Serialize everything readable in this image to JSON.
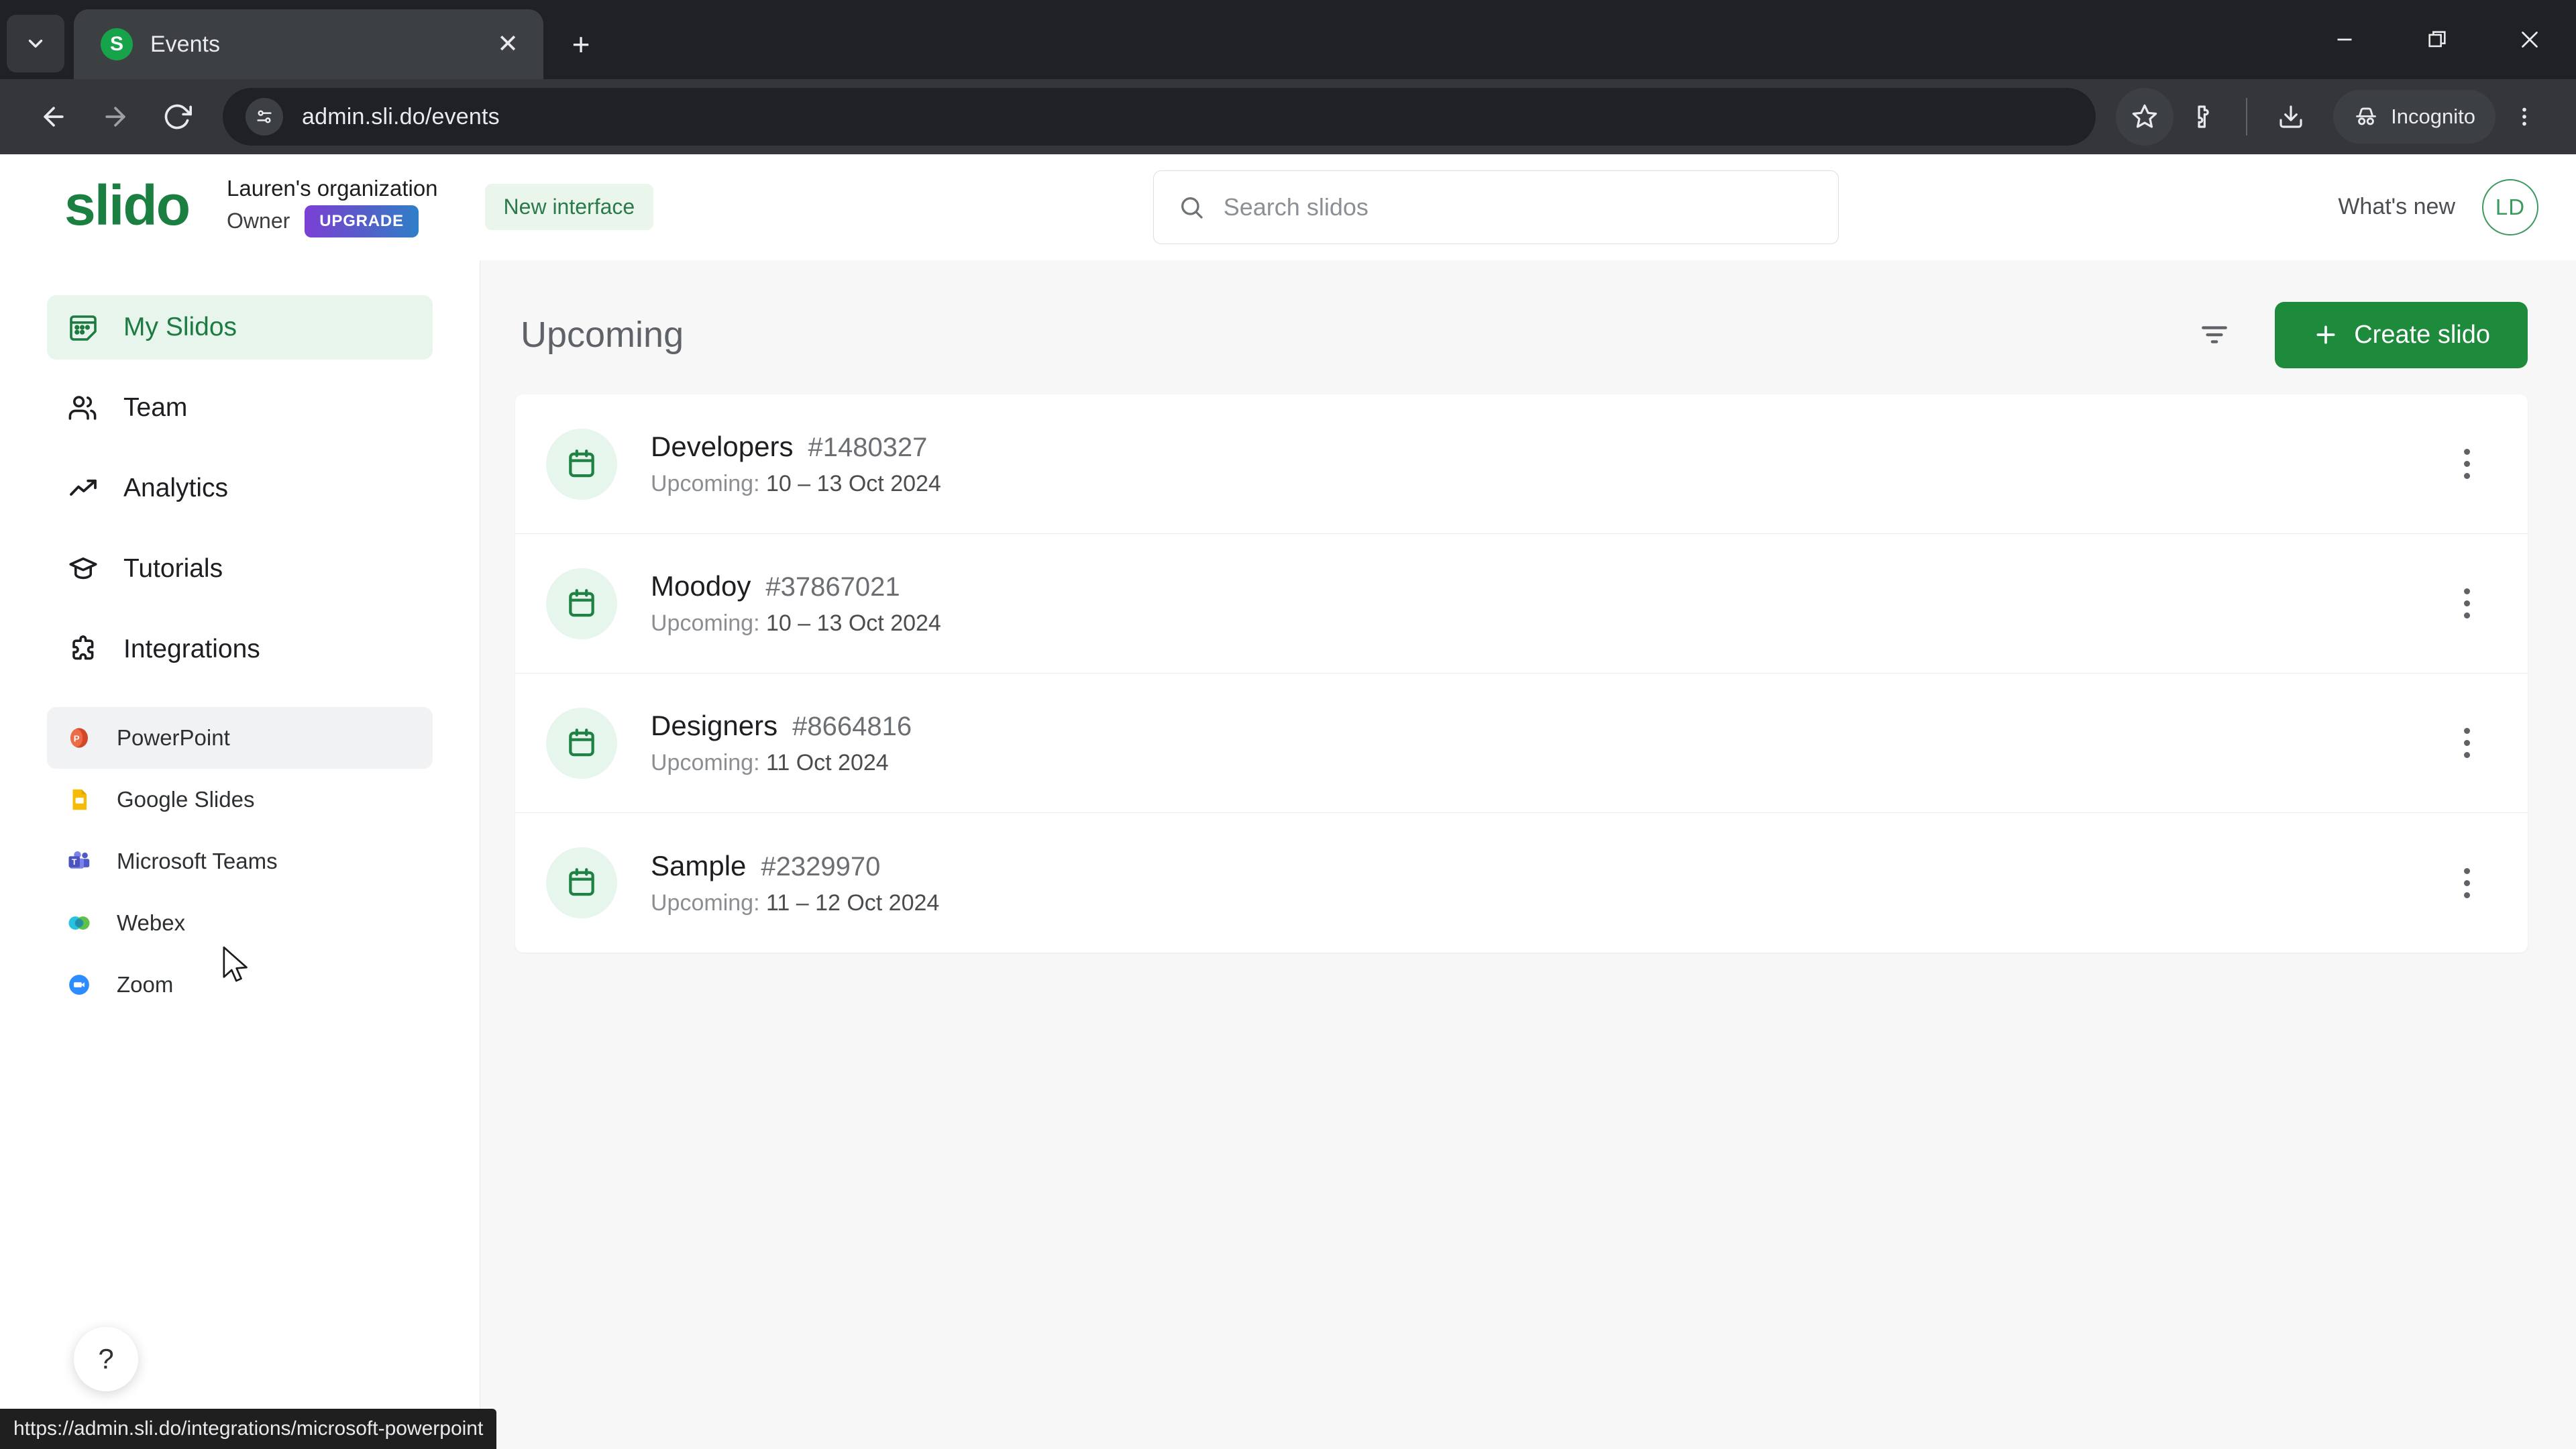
{
  "browser": {
    "tab": {
      "title": "Events",
      "favicon_letter": "S",
      "favicon_name": "slido-favicon"
    },
    "tab_list_icon": "chevron-down-icon",
    "new_tab_icon": "plus-icon",
    "window_controls": [
      "minimize-icon",
      "restore-icon",
      "close-icon"
    ],
    "nav": {
      "back": "back-arrow-icon",
      "forward": "forward-arrow-icon",
      "reload": "reload-icon"
    },
    "omnibox": {
      "site_info_icon": "site-settings-icon",
      "url": "admin.sli.do/events"
    },
    "actions": {
      "bookmark": "star-icon",
      "extensions": "extensions-puzzle-icon",
      "downloads": "download-icon",
      "profile_label": "Incognito",
      "profile_icon": "incognito-hat-icon",
      "menu": "three-dot-menu-icon"
    },
    "status_url": "https://admin.sli.do/integrations/microsoft-powerpoint"
  },
  "header": {
    "logo": "slido",
    "org_name": "Lauren's organization",
    "org_role": "Owner",
    "upgrade_label": "UPGRADE",
    "new_interface_label": "New interface",
    "search_placeholder": "Search slidos",
    "search_value": "",
    "whats_new_label": "What's new",
    "avatar_initials": "LD"
  },
  "sidebar": {
    "items": [
      {
        "label": "My Slidos",
        "icon": "calendar-grid-icon",
        "active": true
      },
      {
        "label": "Team",
        "icon": "people-icon",
        "active": false
      },
      {
        "label": "Analytics",
        "icon": "trend-up-icon",
        "active": false
      },
      {
        "label": "Tutorials",
        "icon": "graduation-cap-icon",
        "active": false
      },
      {
        "label": "Integrations",
        "icon": "puzzle-piece-icon",
        "active": false
      }
    ],
    "integrations": [
      {
        "label": "PowerPoint",
        "icon": "powerpoint-icon",
        "hovered": true
      },
      {
        "label": "Google Slides",
        "icon": "google-slides-icon",
        "hovered": false
      },
      {
        "label": "Microsoft Teams",
        "icon": "microsoft-teams-icon",
        "hovered": false
      },
      {
        "label": "Webex",
        "icon": "webex-icon",
        "hovered": false
      },
      {
        "label": "Zoom",
        "icon": "zoom-icon",
        "hovered": false
      }
    ],
    "help_label": "?"
  },
  "main": {
    "title": "Upcoming",
    "filter_icon": "filter-icon",
    "create_button": {
      "label": "Create slido",
      "icon": "plus-icon"
    },
    "events": [
      {
        "name": "Developers",
        "code": "#1480327",
        "status_prefix": "Upcoming:",
        "dates": "10 – 13 Oct 2024"
      },
      {
        "name": "Moodoy",
        "code": "#37867021",
        "status_prefix": "Upcoming:",
        "dates": "10 – 13 Oct 2024"
      },
      {
        "name": "Designers",
        "code": "#8664816",
        "status_prefix": "Upcoming:",
        "dates": "11 Oct 2024"
      },
      {
        "name": "Sample",
        "code": "#2329970",
        "status_prefix": "Upcoming:",
        "dates": "11 – 12 Oct 2024"
      }
    ]
  },
  "colors": {
    "brand_green": "#1a7f40",
    "button_green": "#1e8a3c",
    "active_nav_bg": "#e8f5ec",
    "chrome_dark": "#202124"
  }
}
